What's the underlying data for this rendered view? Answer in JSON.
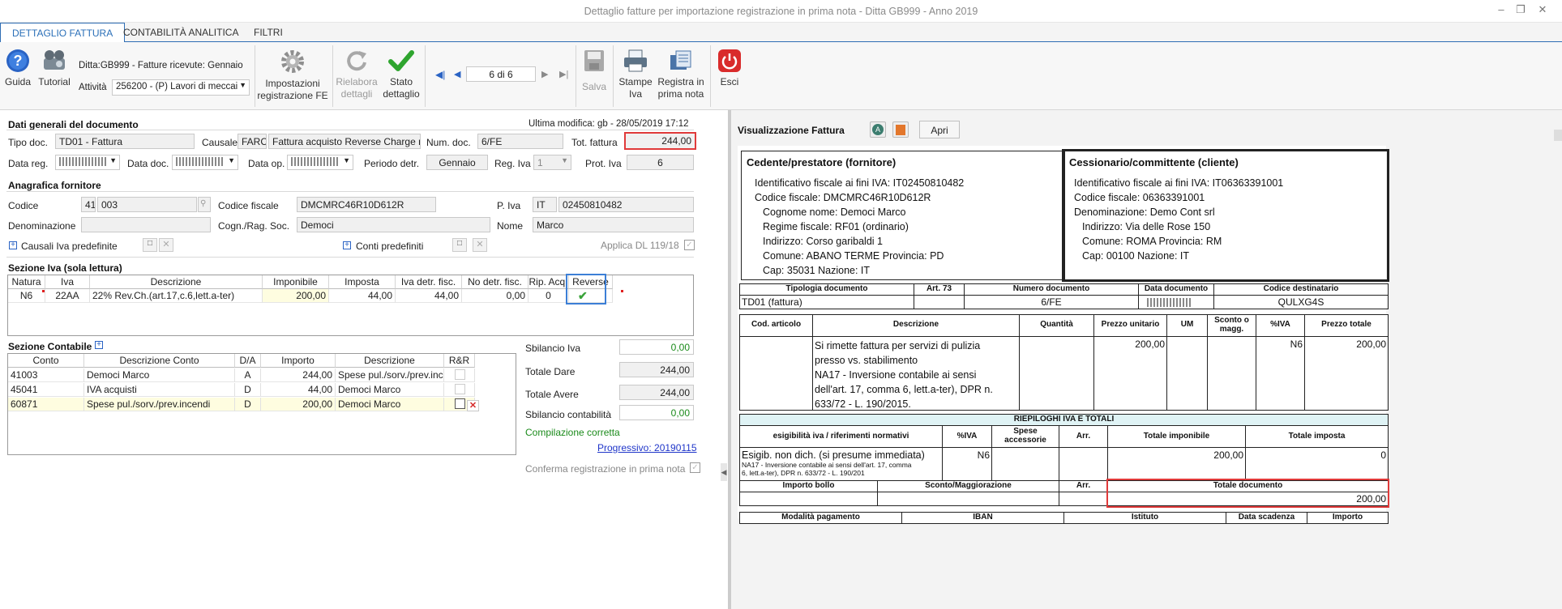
{
  "window": {
    "title": "Dettaglio fatture per importazione registrazione in prima nota - Ditta GB999 - Anno 2019"
  },
  "tabs": [
    "DETTAGLIO FATTURA",
    "CONTABILITÀ ANALITICA",
    "FILTRI"
  ],
  "toolbar": {
    "guida": "Guida",
    "tutorial": "Tutorial",
    "ditta": "Ditta:GB999 - Fatture ricevute: Gennaio",
    "attivita_label": "Attività",
    "attivita_value": "256200 - (P) Lavori di meccai",
    "impostazioni": [
      "Impostazioni",
      "registrazione FE"
    ],
    "rielabora": [
      "Rielabora",
      "dettagli"
    ],
    "stato": [
      "Stato",
      "dettaglio"
    ],
    "nav": "6 di 6",
    "salva": "Salva",
    "stampe": [
      "Stampe",
      "Iva"
    ],
    "registra": [
      "Registra in",
      "prima nota"
    ],
    "esci": "Esci"
  },
  "dati": {
    "title": "Dati generali del documento",
    "ultima": "Ultima modifica: gb - 28/05/2019 17:12",
    "tipo_label": "Tipo doc.",
    "tipo": "TD01 - Fattura",
    "causale_label": "Causale",
    "causale_code": "FARC",
    "causale_desc": "Fattura acquisto Reverse Charge n.",
    "numdoc_label": "Num. doc.",
    "numdoc": "6/FE",
    "tot_label": "Tot. fattura",
    "tot": "244,00",
    "datareg_label": "Data reg.",
    "datadoc_label": "Data doc.",
    "dataop_label": "Data op.",
    "periodo_label": "Periodo detr.",
    "periodo": "Gennaio",
    "regiva_label": "Reg. Iva",
    "regiva": "1",
    "prot_label": "Prot. Iva",
    "prot": "6"
  },
  "anag": {
    "title": "Anagrafica fornitore",
    "codice_label": "Codice",
    "codice_a": "41",
    "codice_b": "003",
    "cf_label": "Codice fiscale",
    "cf": "DMCMRC46R10D612R",
    "piva_label": "P. Iva",
    "piva_country": "IT",
    "piva": "02450810482",
    "denom_label": "Denominazione",
    "cogn_label": "Cogn./Rag. Soc.",
    "cogn": "Democi",
    "nome_label": "Nome",
    "nome": "Marco",
    "causali": "Causali Iva predefinite",
    "conti": "Conti predefiniti",
    "applica": "Applica DL 119/18"
  },
  "iva": {
    "title": "Sezione Iva (sola lettura)",
    "headers": [
      "Natura",
      "Iva",
      "Descrizione",
      "Imponibile",
      "Imposta",
      "Iva detr. fisc.",
      "No detr. fisc.",
      "Rip. Acq.",
      "Reverse"
    ],
    "row": [
      "N6",
      "22AA",
      "22% Rev.Ch.(art.17,c.6,lett.a-ter)",
      "200,00",
      "44,00",
      "44,00",
      "0,00",
      "0"
    ]
  },
  "contabile": {
    "title": "Sezione Contabile",
    "headers": [
      "Conto",
      "Descrizione Conto",
      "D/A",
      "Importo",
      "Descrizione",
      "R&R"
    ],
    "rows": [
      [
        "41003",
        "Democi Marco",
        "A",
        "244,00",
        "Spese pul./sorv./prev.inc"
      ],
      [
        "45041",
        "IVA acquisti",
        "D",
        "44,00",
        "Democi Marco"
      ],
      [
        "60871",
        "Spese pul./sorv./prev.incendi",
        "D",
        "200,00",
        "Democi Marco"
      ]
    ],
    "sbil_iva_label": "Sbilancio Iva",
    "sbil_iva": "0,00",
    "dare_label": "Totale Dare",
    "dare": "244,00",
    "avere_label": "Totale Avere",
    "avere": "244,00",
    "sbil_cont_label": "Sbilancio contabilità",
    "sbil_cont": "0,00",
    "ok": "Compilazione corretta",
    "progressivo": "Progressivo: 20190115",
    "conferma": "Conferma registrazione in prima nota"
  },
  "viewer": {
    "title": "Visualizzazione Fattura",
    "apri": "Apri"
  },
  "invoice": {
    "cedente_title": "Cedente/prestatore (fornitore)",
    "cedente": [
      "Identificativo fiscale ai fini IVA: IT02450810482",
      "Codice fiscale: DMCMRC46R10D612R",
      "Cognome nome: Democi Marco",
      "Regime fiscale: RF01 (ordinario)",
      "Indirizzo: Corso garibaldi 1",
      "Comune: ABANO TERME Provincia: PD",
      "Cap: 35031 Nazione: IT"
    ],
    "cessionario_title": "Cessionario/committente (cliente)",
    "cessionario": [
      "Identificativo fiscale ai fini IVA: IT06363391001",
      "Codice fiscale: 06363391001",
      "Denominazione: Demo Cont srl",
      "Indirizzo: Via delle Rose 150",
      "Comune: ROMA Provincia: RM",
      "Cap: 00100 Nazione: IT"
    ],
    "h1": [
      "Tipologia documento",
      "Art. 73",
      "Numero documento",
      "Data documento",
      "Codice destinatario"
    ],
    "r1": [
      "TD01 (fattura)",
      "",
      "6/FE",
      "",
      "QULXG4S"
    ],
    "h2": [
      "Cod. articolo",
      "Descrizione",
      "Quantità",
      "Prezzo unitario",
      "UM",
      "Sconto o magg.",
      "%IVA",
      "Prezzo totale"
    ],
    "r2_desc": [
      "Si rimette fattura per servizi di pulizia",
      "presso vs. stabilimento",
      "NA17 - Inversione contabile ai sensi",
      "dell'art. 17, comma 6, lett.a-ter), DPR n.",
      "633/72 - L. 190/2015."
    ],
    "r2_prezzo": "200,00",
    "r2_iva": "N6",
    "r2_tot": "200,00",
    "riepilogo": "RIEPILOGHI IVA E TOTALI",
    "h3": [
      "esigibilità iva / riferimenti normativi",
      "%IVA",
      "Spese accessorie",
      "Arr.",
      "Totale imponibile",
      "Totale imposta"
    ],
    "r3_a": "Esigib. non dich. (si presume immediata)",
    "r3_b": [
      "NA17 - Inversione contabile ai sensi dell'art. 17, comma",
      "6, lett.a-ter), DPR n. 633/72 - L. 190/201"
    ],
    "r3_iva": "N6",
    "r3_imp": "200,00",
    "r3_imposta": "0",
    "h4": [
      "Importo bollo",
      "Sconto/Maggiorazione",
      "Arr.",
      "Totale documento"
    ],
    "totdoc": "200,00",
    "h5": [
      "Modalità pagamento",
      "IBAN",
      "Istituto",
      "Data scadenza",
      "Importo"
    ]
  }
}
